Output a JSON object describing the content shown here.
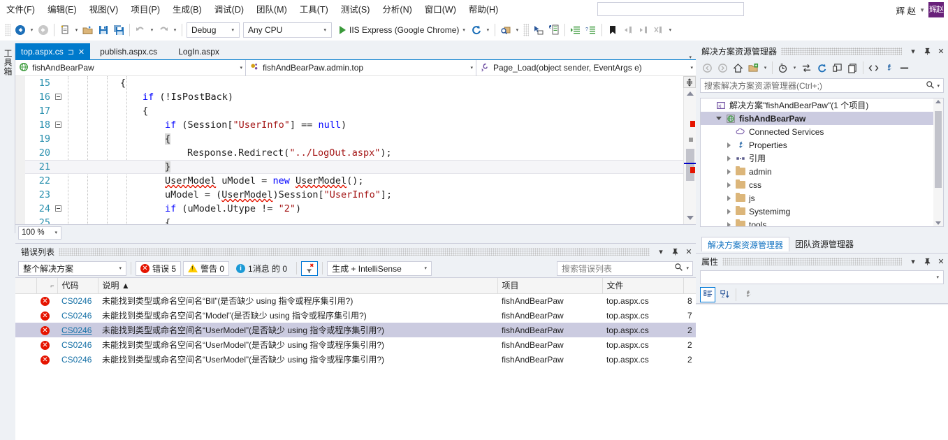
{
  "app": {
    "theme_accent": "#007acc",
    "error_color": "#e51400",
    "warning_color": "#ffcc00",
    "info_color": "#1b9ad6",
    "selection_color": "#cbcbe0"
  },
  "menubar": {
    "items": [
      {
        "label": "文件(F)",
        "name": "menu-file"
      },
      {
        "label": "编辑(E)",
        "name": "menu-edit"
      },
      {
        "label": "视图(V)",
        "name": "menu-view"
      },
      {
        "label": "项目(P)",
        "name": "menu-project"
      },
      {
        "label": "生成(B)",
        "name": "menu-build"
      },
      {
        "label": "调试(D)",
        "name": "menu-debug"
      },
      {
        "label": "团队(M)",
        "name": "menu-team"
      },
      {
        "label": "工具(T)",
        "name": "menu-tools"
      },
      {
        "label": "测试(S)",
        "name": "menu-test"
      },
      {
        "label": "分析(N)",
        "name": "menu-analyze"
      },
      {
        "label": "窗口(W)",
        "name": "menu-window"
      },
      {
        "label": "帮助(H)",
        "name": "menu-help"
      }
    ],
    "user_name": "辉 赵",
    "user_caret": "▼",
    "avatar_text": "辉赵"
  },
  "toolbar": {
    "nav_back_icon": "back-arrow-icon",
    "nav_forward_icon": "forward-arrow-icon",
    "new_item_icon": "new-item-icon",
    "open_icon": "open-folder-icon",
    "save_icon": "save-icon",
    "save_all_icon": "save-all-icon",
    "undo_icon": "undo-icon",
    "redo_icon": "redo-icon",
    "configuration": "Debug",
    "platform": "Any CPU",
    "run_target": "IIS Express (Google Chrome)",
    "refresh_icon": "refresh-icon",
    "find_icon": "find-in-files-icon",
    "caret": "▾"
  },
  "toolbox": {
    "label": "工具箱"
  },
  "editor": {
    "tabs": [
      {
        "label": "top.aspx.cs",
        "active": true,
        "pin": "⊐",
        "close": "✕"
      },
      {
        "label": "publish.aspx.cs",
        "active": false
      },
      {
        "label": "LogIn.aspx",
        "active": false
      }
    ],
    "nav": {
      "project": "fishAndBearPaw",
      "project_icon": "web-project-icon",
      "class": "fishAndBearPaw.admin.top",
      "class_icon": "class-icon",
      "member": "Page_Load(object sender, EventArgs e)",
      "member_icon": "method-icon",
      "arrow": "▾"
    },
    "zoom_level": "100 %",
    "zoom_arrow": "▾",
    "lines": [
      {
        "num": "15",
        "fold": "none",
        "indent": 10,
        "tokens": [
          {
            "t": "{",
            "c": "typ"
          }
        ]
      },
      {
        "num": "16",
        "fold": "minus",
        "indent": 14,
        "tokens": [
          {
            "t": "if",
            "c": "kw"
          },
          {
            "t": " (!IsPostBack)",
            "c": "typ"
          }
        ]
      },
      {
        "num": "17",
        "fold": "none",
        "indent": 14,
        "tokens": [
          {
            "t": "{",
            "c": "typ"
          }
        ]
      },
      {
        "num": "18",
        "fold": "minus",
        "indent": 18,
        "tokens": [
          {
            "t": "if",
            "c": "kw"
          },
          {
            "t": " (Session[",
            "c": "typ"
          },
          {
            "t": "\"UserInfo\"",
            "c": "str"
          },
          {
            "t": "] == ",
            "c": "typ"
          },
          {
            "t": "null",
            "c": "kw"
          },
          {
            "t": ")",
            "c": "typ"
          }
        ]
      },
      {
        "num": "19",
        "fold": "none",
        "indent": 18,
        "tokens": [
          {
            "t": "{",
            "c": "brace"
          }
        ]
      },
      {
        "num": "20",
        "fold": "none",
        "indent": 22,
        "tokens": [
          {
            "t": "Response.Redirect(",
            "c": "typ"
          },
          {
            "t": "\"../LogOut.aspx\"",
            "c": "str"
          },
          {
            "t": ");",
            "c": "typ"
          }
        ]
      },
      {
        "num": "21",
        "fold": "none",
        "indent": 18,
        "current": true,
        "tokens": [
          {
            "t": "}",
            "c": "brace"
          }
        ]
      },
      {
        "num": "22",
        "fold": "none",
        "indent": 18,
        "tokens": [
          {
            "t": "UserModel",
            "c": "sq"
          },
          {
            "t": " uModel = ",
            "c": "typ"
          },
          {
            "t": "new",
            "c": "kw"
          },
          {
            "t": " ",
            "c": "typ"
          },
          {
            "t": "UserModel",
            "c": "sq"
          },
          {
            "t": "();",
            "c": "typ"
          }
        ]
      },
      {
        "num": "23",
        "fold": "none",
        "indent": 18,
        "tokens": [
          {
            "t": "uModel = (",
            "c": "typ"
          },
          {
            "t": "UserModel",
            "c": "sq"
          },
          {
            "t": ")Session[",
            "c": "typ"
          },
          {
            "t": "\"UserInfo\"",
            "c": "str"
          },
          {
            "t": "];",
            "c": "typ"
          }
        ]
      },
      {
        "num": "24",
        "fold": "minus",
        "indent": 18,
        "tokens": [
          {
            "t": "if",
            "c": "kw"
          },
          {
            "t": " (uModel.Utype != ",
            "c": "typ"
          },
          {
            "t": "\"2\"",
            "c": "str"
          },
          {
            "t": ")",
            "c": "typ"
          }
        ]
      },
      {
        "num": "25",
        "fold": "none",
        "indent": 18,
        "tokens": [
          {
            "t": "{",
            "c": "typ"
          }
        ]
      }
    ]
  },
  "error_panel": {
    "title": "错误列表",
    "dropdown_icon": "chevron-down-icon",
    "pin_icon": "pin-icon",
    "close_icon": "close-icon",
    "scope": "整个解决方案",
    "errors_label": "错误 5",
    "warnings_label": "警告 0",
    "messages_label": "1消息 的 0",
    "filter_icon": "clear-filter-icon",
    "build_filter": "生成 + IntelliSense",
    "search_placeholder": "搜索错误列表",
    "search_icon": "search-icon",
    "columns": [
      {
        "label": "",
        "name": "col-icon"
      },
      {
        "label": "代码",
        "name": "col-code"
      },
      {
        "label": "说明 ▲",
        "name": "col-description"
      },
      {
        "label": "项目",
        "name": "col-project"
      },
      {
        "label": "文件",
        "name": "col-file"
      },
      {
        "label": "",
        "name": "col-line"
      }
    ],
    "rows": [
      {
        "severity": "error",
        "code": "CS0246",
        "description": "未能找到类型或命名空间名“Bll”(是否缺少 using 指令或程序集引用?)",
        "project": "fishAndBearPaw",
        "file": "top.aspx.cs",
        "line": "8",
        "selected": false
      },
      {
        "severity": "error",
        "code": "CS0246",
        "description": "未能找到类型或命名空间名“Model”(是否缺少 using 指令或程序集引用?)",
        "project": "fishAndBearPaw",
        "file": "top.aspx.cs",
        "line": "7",
        "selected": false
      },
      {
        "severity": "error",
        "code": "CS0246",
        "description": "未能找到类型或命名空间名“UserModel”(是否缺少 using 指令或程序集引用?)",
        "project": "fishAndBearPaw",
        "file": "top.aspx.cs",
        "line": "2",
        "selected": true
      },
      {
        "severity": "error",
        "code": "CS0246",
        "description": "未能找到类型或命名空间名“UserModel”(是否缺少 using 指令或程序集引用?)",
        "project": "fishAndBearPaw",
        "file": "top.aspx.cs",
        "line": "2",
        "selected": false
      },
      {
        "severity": "error",
        "code": "CS0246",
        "description": "未能找到类型或命名空间名“UserModel”(是否缺少 using 指令或程序集引用?)",
        "project": "fishAndBearPaw",
        "file": "top.aspx.cs",
        "line": "2",
        "selected": false
      }
    ]
  },
  "solution_explorer": {
    "title": "解决方案资源管理器",
    "search_placeholder": "搜索解决方案资源管理器(Ctrl+;)",
    "toolbar_icons": [
      "back-icon",
      "forward-icon",
      "home-icon",
      "show-all-files-icon",
      "pending-changes-icon",
      "sync-icon",
      "refresh-icon",
      "collapse-all-icon",
      "properties-page-icon",
      "view-code-icon",
      "properties-icon",
      "preview-icon"
    ],
    "tree": [
      {
        "label": "解决方案\"fishAndBearPaw\"(1 个项目)",
        "depth": 0,
        "twisty": "none",
        "icon": "solution-icon",
        "selected": false,
        "bold": false
      },
      {
        "label": "fishAndBearPaw",
        "depth": 1,
        "twisty": "down",
        "icon": "web-project-icon",
        "selected": true,
        "bold": true
      },
      {
        "label": "Connected Services",
        "depth": 2,
        "twisty": "none",
        "icon": "connected-services-icon",
        "selected": false,
        "bold": false
      },
      {
        "label": "Properties",
        "depth": 2,
        "twisty": "right",
        "icon": "wrench-icon",
        "selected": false,
        "bold": false
      },
      {
        "label": "引用",
        "depth": 2,
        "twisty": "right",
        "icon": "references-icon",
        "selected": false,
        "bold": false
      },
      {
        "label": "admin",
        "depth": 2,
        "twisty": "right",
        "icon": "folder-icon",
        "selected": false,
        "bold": false
      },
      {
        "label": "css",
        "depth": 2,
        "twisty": "right",
        "icon": "folder-icon",
        "selected": false,
        "bold": false
      },
      {
        "label": "js",
        "depth": 2,
        "twisty": "right",
        "icon": "folder-icon",
        "selected": false,
        "bold": false
      },
      {
        "label": "Systemimg",
        "depth": 2,
        "twisty": "right",
        "icon": "folder-icon",
        "selected": false,
        "bold": false
      },
      {
        "label": "tools",
        "depth": 2,
        "twisty": "right",
        "icon": "folder-icon",
        "selected": false,
        "bold": false
      }
    ]
  },
  "dock_tabs": [
    {
      "label": "解决方案资源管理器",
      "active": true
    },
    {
      "label": "团队资源管理器",
      "active": false
    }
  ],
  "properties": {
    "title": "属性",
    "selected_object": "",
    "dropdown_icon": "chevron-down-icon",
    "pin_icon": "pin-icon",
    "close_icon": "close-icon",
    "categorized_icon": "categorized-view-icon",
    "alphabetical_icon": "alphabetical-sort-icon",
    "property_pages_icon": "property-pages-icon"
  }
}
